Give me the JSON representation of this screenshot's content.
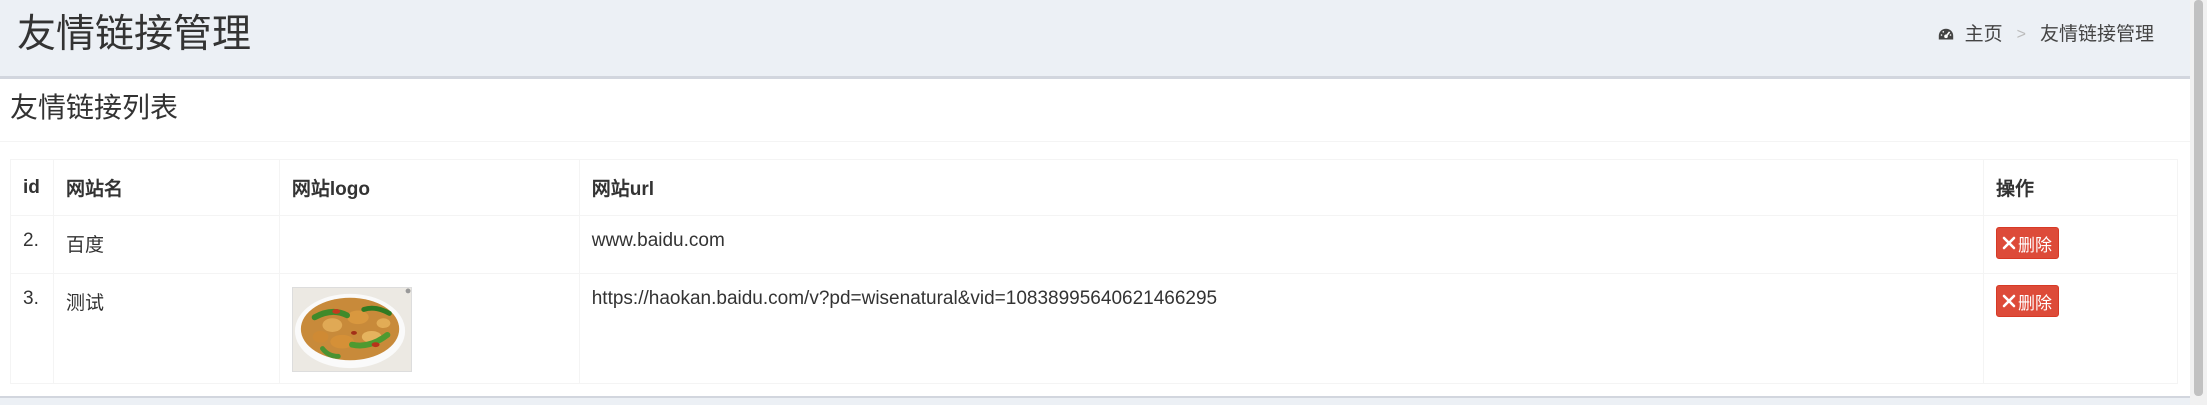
{
  "header": {
    "title": "友情链接管理"
  },
  "breadcrumb": {
    "icon": "dashboard-icon",
    "home": "主页",
    "separator": ">",
    "current": "友情链接管理"
  },
  "box": {
    "title": "友情链接列表"
  },
  "table": {
    "columns": [
      "id",
      "网站名",
      "网站logo",
      "网站url",
      "操作"
    ],
    "rows": [
      {
        "id": "2.",
        "name": "百度",
        "logo": "",
        "url": "www.baidu.com",
        "action": "删除"
      },
      {
        "id": "3.",
        "name": "测试",
        "logo": "food-image",
        "url": "https://haokan.baidu.com/v?pd=wisenatural&vid=10838995640621466295",
        "action": "删除"
      }
    ]
  },
  "colors": {
    "danger": "#dd4b39",
    "page_bg": "#ecf0f5",
    "box_border": "#d2d6de"
  }
}
